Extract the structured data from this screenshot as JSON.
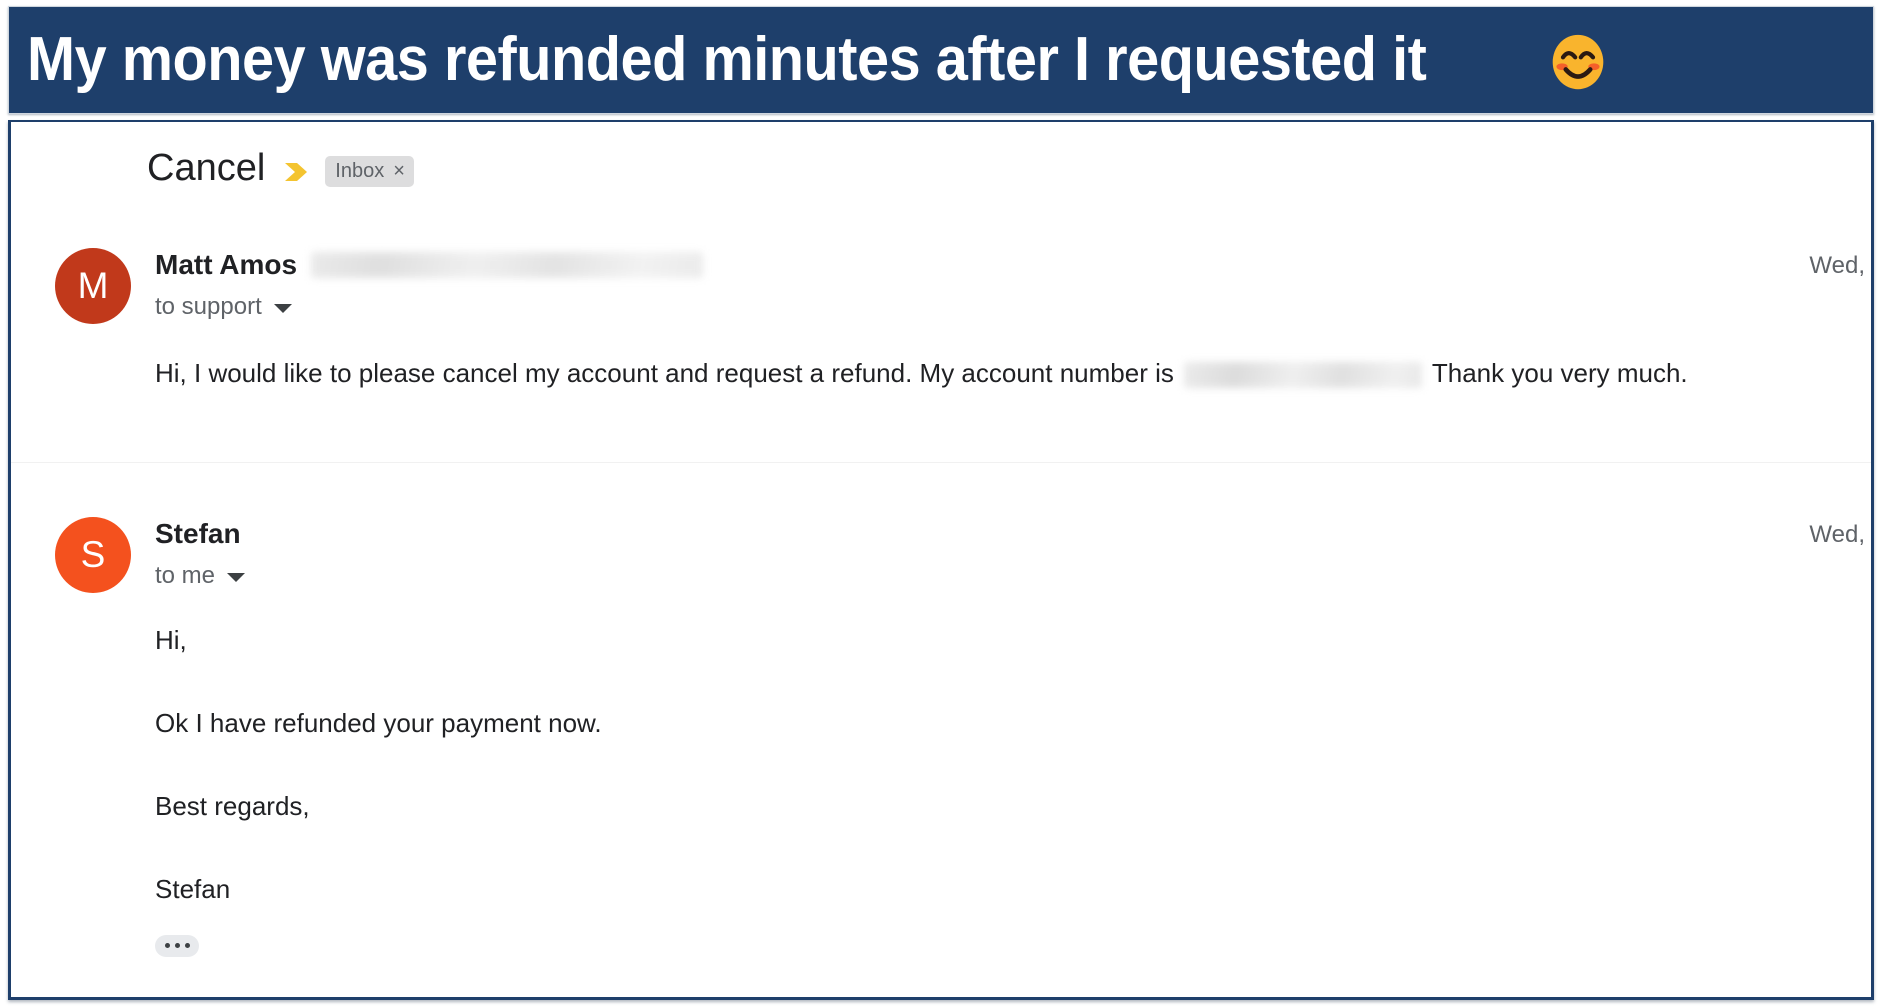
{
  "banner": {
    "title": "My money was refunded minutes after I requested it",
    "emoji_name": "smiling-face-with-smiling-eyes",
    "bg_color": "#1e3f6b",
    "text_color": "#ffffff"
  },
  "email": {
    "subject": "Cancel",
    "important_marker_color": "#f4c430",
    "label": {
      "text": "Inbox",
      "remove": "×"
    },
    "messages": [
      {
        "avatar_letter": "M",
        "avatar_color": "#c1391b",
        "sender": "Matt Amos",
        "sender_email_redacted": true,
        "recipient": "to support",
        "timestamp": "Wed,",
        "body_lines": [
          {
            "before": "Hi, I would like to please cancel my account and request a refund. My account number is",
            "redacted": true,
            "after": "Thank you very much."
          }
        ]
      },
      {
        "avatar_letter": "S",
        "avatar_color": "#f4511e",
        "sender": "Stefan",
        "sender_email_redacted": false,
        "recipient": "to me",
        "timestamp": "Wed,",
        "body_lines": [
          {
            "before": "Hi,",
            "redacted": false,
            "after": ""
          },
          {
            "before": "Ok I have refunded your payment now.",
            "redacted": false,
            "after": ""
          },
          {
            "before": "Best regards,",
            "redacted": false,
            "after": ""
          },
          {
            "before": "Stefan",
            "redacted": false,
            "after": ""
          }
        ],
        "trimmed_content_button": "•••"
      }
    ]
  }
}
